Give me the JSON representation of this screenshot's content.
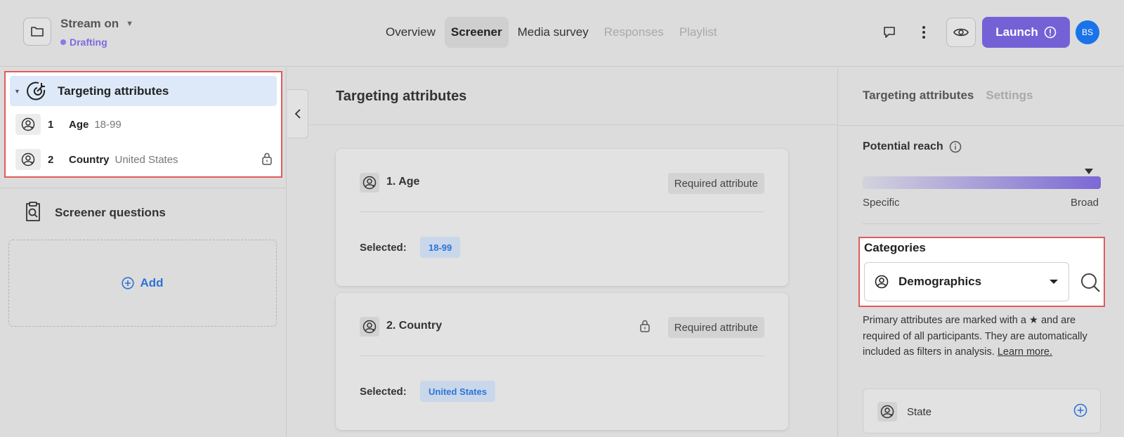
{
  "header": {
    "project_name": "Stream on",
    "status": "Drafting",
    "tabs": [
      {
        "label": "Overview",
        "state": "normal"
      },
      {
        "label": "Screener",
        "state": "active"
      },
      {
        "label": "Media survey",
        "state": "normal"
      },
      {
        "label": "Responses",
        "state": "disabled"
      },
      {
        "label": "Playlist",
        "state": "disabled"
      }
    ],
    "launch_label": "Launch",
    "avatar_initials": "BS"
  },
  "sidebar": {
    "targeting_title": "Targeting attributes",
    "attributes": [
      {
        "num": "1",
        "name": "Age",
        "value": "18-99",
        "locked": false
      },
      {
        "num": "2",
        "name": "Country",
        "value": "United States",
        "locked": true
      }
    ],
    "screener_title": "Screener questions",
    "add_label": "Add"
  },
  "main": {
    "title": "Targeting attributes",
    "cards": [
      {
        "title": "1. Age",
        "badge": "Required attribute",
        "selected_label": "Selected:",
        "chip": "18-99",
        "locked": false
      },
      {
        "title": "2. Country",
        "badge": "Required attribute",
        "selected_label": "Selected:",
        "chip": "United States",
        "locked": true
      }
    ]
  },
  "right": {
    "tabs": [
      {
        "label": "Targeting attributes",
        "state": "active"
      },
      {
        "label": "Settings",
        "state": "disabled"
      }
    ],
    "reach_title": "Potential reach",
    "reach_level": 0.95,
    "reach_min_label": "Specific",
    "reach_max_label": "Broad",
    "categories_title": "Categories",
    "category_selected": "Demographics",
    "primary_text": "Primary attributes are marked with a ★ and are required of all participants. They are automatically included as filters in analysis.",
    "learn_more": "Learn more.",
    "list": [
      {
        "name": "State"
      }
    ]
  },
  "colors": {
    "accent": "#7561d6",
    "link": "#2e73d6",
    "highlight": "#e25a5a",
    "status": "#7b6be0"
  },
  "icons": {
    "folder": "folder-icon",
    "comment": "comment-icon",
    "more": "more-vertical-icon",
    "preview": "eye-icon",
    "launch_info": "exclamation-circle-icon",
    "target": "target-icon",
    "person": "person-badge-icon",
    "lock": "lock-icon",
    "clipboard": "clipboard-search-icon",
    "add": "plus-circle-icon",
    "collapse": "chevron-left-icon",
    "info": "info-icon",
    "search": "search-icon"
  }
}
